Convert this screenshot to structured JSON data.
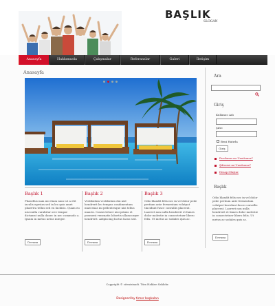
{
  "header": {
    "title": "BAŞLIK",
    "slogan": "SLOGAN"
  },
  "nav": {
    "items": [
      {
        "label": "Anasayfa",
        "active": true
      },
      {
        "label": "Hakkımızda",
        "active": false
      },
      {
        "label": "Çalışmalar",
        "active": false
      },
      {
        "label": "Referanslar",
        "active": false
      },
      {
        "label": "Galeri",
        "active": false
      },
      {
        "label": "İletişim",
        "active": false
      }
    ]
  },
  "main": {
    "heading": "Anasayfa",
    "columns": [
      {
        "title": "Başlık 1",
        "text": "Phasellus nam mi etiam nunc ut a elit iaculis egestas sed in leo quis amet pharetra tellus sed eu facilisis. Quam eu nisi nulla curabitur orci tempor dictumst nulla donec in nec commodo a. Ipsum in metus netus integer.",
        "button": "Devamı"
      },
      {
        "title": "Başlık 2",
        "text": "Vestibulum vestibulum dui nisl hendrerit leo tempus condimentum maecenas mi pellentesque nisi tellus mauris. Consectetuer nisi primis et praesent venenatis lobortis ullamcorper hendrerit. Adipiscing luctus lacus sed.",
        "button": "Devamı"
      },
      {
        "title": "Başlık 3",
        "text": "Odio blandit felis nec in vel dolor pede pretium ante fermentum volutpat tincidunt fusce convallis placerat. Laoreet non nulla hendrerit et fames dolor molestie in consectetuer libero felis. Ut metus ac sodales quis ac.",
        "button": "Devamı"
      }
    ]
  },
  "sidebar": {
    "search_heading": "Ara",
    "login_heading": "Giriş",
    "username_label": "Kullanıcı Adı",
    "password_label": "Şifre",
    "remember_label": "Beni Hatırla",
    "login_button": "Giriş",
    "links": [
      "Parolanızı mı Unuttunuz?",
      "Şifrenizi mi Unuttunuz?",
      "Hesap Oluştur"
    ],
    "about_heading": "Başlık",
    "about_text": "Odio blandit felis nec in vel dolor pede pretium ante fermentum volutpat tincidunt fusce convallis placerat. Laoreet non nulla hendrerit et fames dolor molestie in consectetuer libero felis. Ut metus ac sodales quis ac.",
    "about_button": "Devamı"
  },
  "footer": {
    "copyright": "Copyright © sitenizinadi. Tüm Hakları Saklıdır.",
    "credit_prefix": "Designed by",
    "credit_link": "timer başkalan"
  },
  "colors": {
    "accent": "#d3102a",
    "nav_bg": "#2b2b2b"
  }
}
